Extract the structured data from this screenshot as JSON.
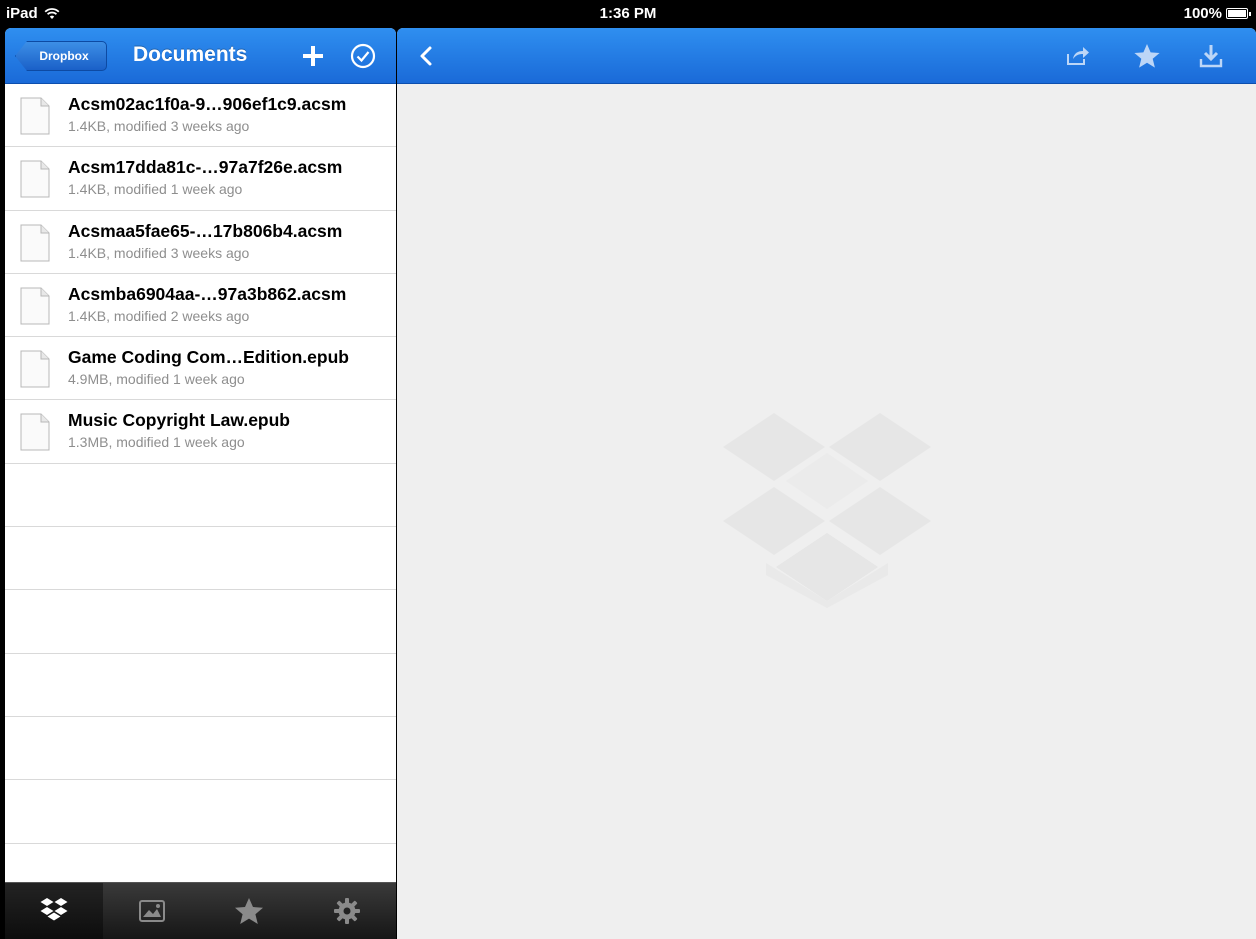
{
  "status_bar": {
    "device": "iPad",
    "time": "1:36 PM",
    "battery": "100%"
  },
  "left_nav": {
    "back_label": "Dropbox",
    "title": "Documents"
  },
  "files": [
    {
      "name": "Acsm02ac1f0a-9…906ef1c9.acsm",
      "meta": "1.4KB, modified 3 weeks ago"
    },
    {
      "name": "Acsm17dda81c-…97a7f26e.acsm",
      "meta": "1.4KB, modified 1 week ago"
    },
    {
      "name": "Acsmaa5fae65-…17b806b4.acsm",
      "meta": "1.4KB, modified 3 weeks ago"
    },
    {
      "name": "Acsmba6904aa-…97a3b862.acsm",
      "meta": "1.4KB, modified 2 weeks ago"
    },
    {
      "name": "Game Coding Com…Edition.epub",
      "meta": "4.9MB, modified 1 week ago"
    },
    {
      "name": "Music Copyright Law.epub",
      "meta": "1.3MB, modified 1 week ago"
    }
  ],
  "tabs": [
    {
      "icon": "dropbox-icon",
      "active": true
    },
    {
      "icon": "photos-icon",
      "active": false
    },
    {
      "icon": "star-icon",
      "active": false
    },
    {
      "icon": "gear-icon",
      "active": false
    }
  ],
  "colors": {
    "nav_blue": "#1a6ad8",
    "nav_blue_light": "#2f8ff0",
    "meta_gray": "#8e8e8e",
    "detail_bg": "#efefef"
  }
}
